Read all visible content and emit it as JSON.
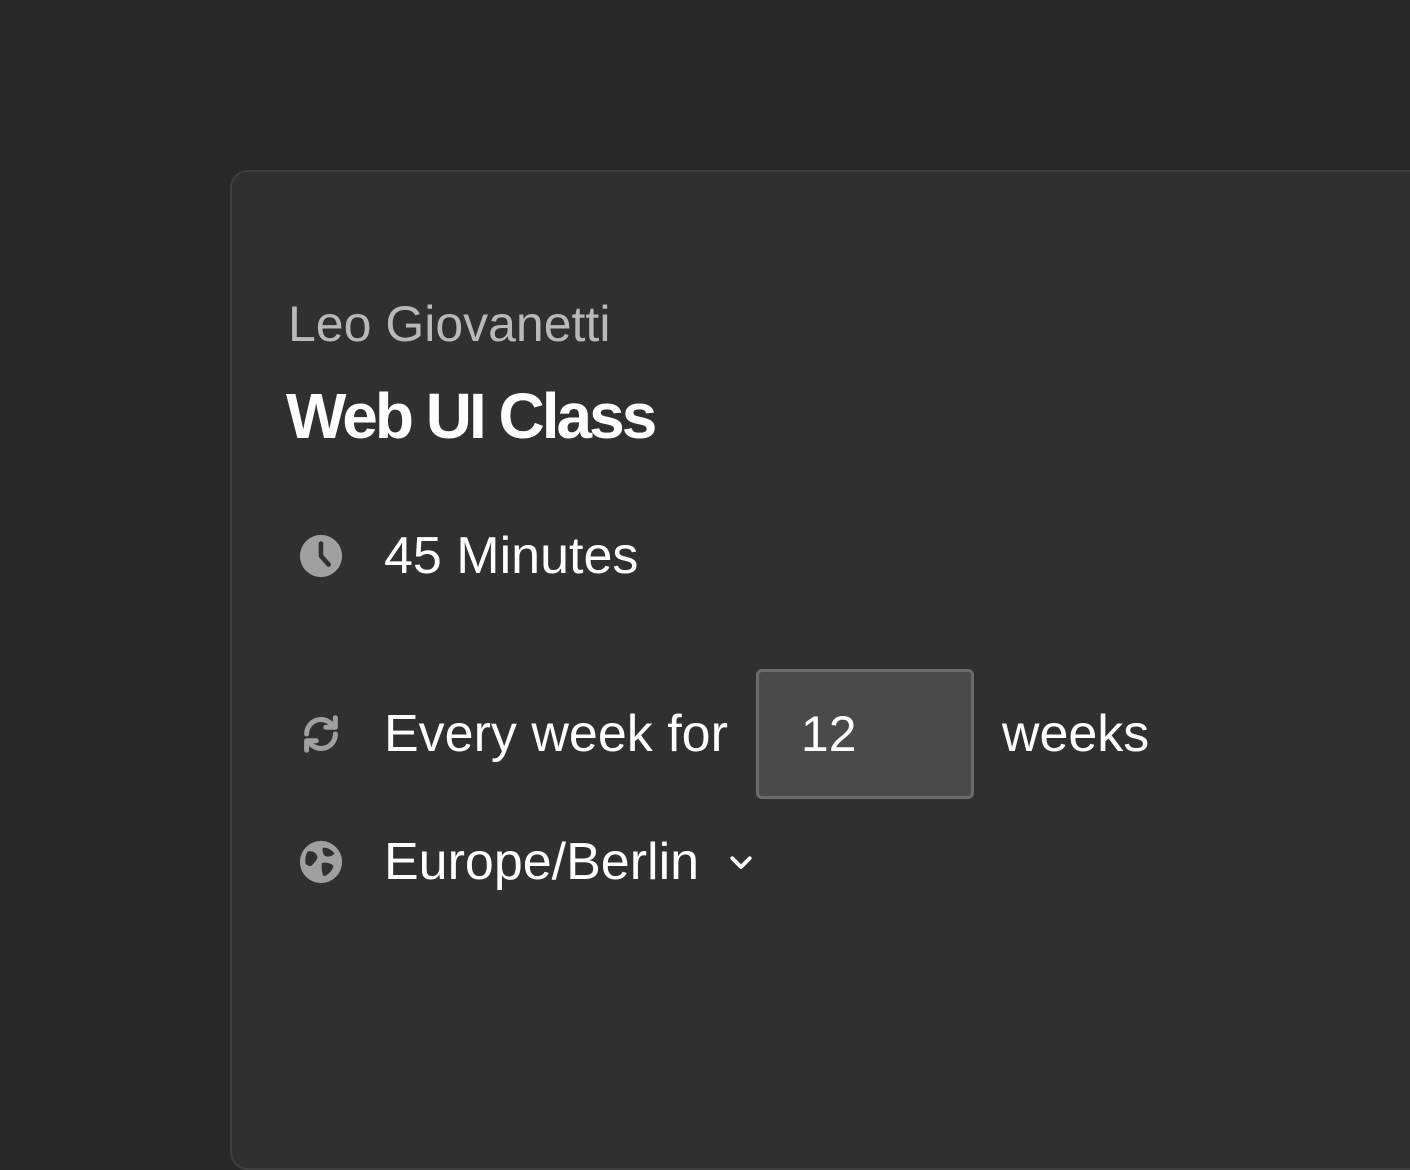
{
  "event": {
    "owner": "Leo Giovanetti",
    "title": "Web UI Class",
    "duration": "45 Minutes",
    "recurrence": {
      "prefix": "Every week for",
      "count": "12",
      "unit": "weeks"
    },
    "timezone": {
      "selected": "Europe/Berlin"
    }
  },
  "icons": {
    "duration": "clock-icon",
    "recurrence": "refresh-icon",
    "timezone": "globe-icon",
    "dropdown": "chevron-down-icon"
  },
  "colors": {
    "background": "#282828",
    "card": "#303030",
    "text": "#ffffff",
    "muted": "#b9b9b9",
    "icon": "#a0a0a0",
    "input_bg": "#4a4a4a",
    "input_border": "#6b6b6b"
  }
}
